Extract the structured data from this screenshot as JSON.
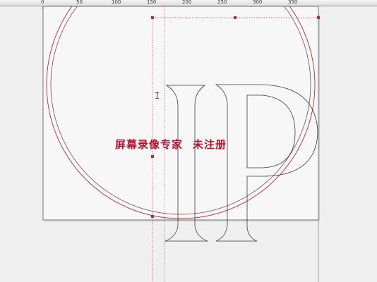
{
  "ruler": {
    "labels": [
      "0",
      "50",
      "100",
      "150",
      "200",
      "250",
      "300",
      "350"
    ]
  },
  "watermark": {
    "text_part1": "屏幕录像专家",
    "text_part2": "未注册"
  },
  "artwork": {
    "glyphs": [
      "I",
      "P"
    ],
    "colors": {
      "outline": "#3a3a3a",
      "circle": "#c0283f",
      "guide": "#d0455a",
      "selection": "#c0283f",
      "watermark": "#b3122e"
    }
  },
  "icons": {
    "cursor": "text-cursor-icon"
  }
}
